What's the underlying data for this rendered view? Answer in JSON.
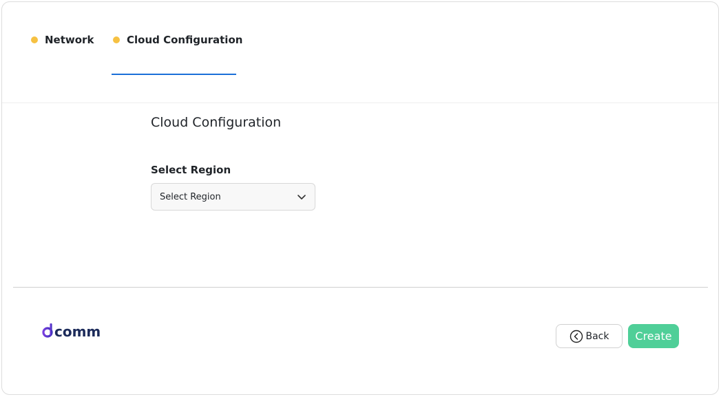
{
  "tabs": [
    {
      "label": "Network"
    },
    {
      "label": "Cloud Configuration"
    }
  ],
  "active_tab": "Cloud Configuration",
  "colors": {
    "tab_dot": "#f6c142",
    "active_underline": "#1a6fd8",
    "create_button": "#4fcf98",
    "logo_accent": "#7a3ee0",
    "logo_text": "#1c2b5a"
  },
  "content": {
    "title": "Cloud Configuration",
    "region": {
      "label": "Select Region",
      "selected": "Select Region"
    }
  },
  "footer": {
    "logo_text": "comm",
    "back_label": "Back",
    "create_label": "Create"
  },
  "icons": {
    "tab_dot": "dot-icon",
    "dropdown": "chevron-down-icon",
    "back": "circle-chevron-left-icon"
  }
}
